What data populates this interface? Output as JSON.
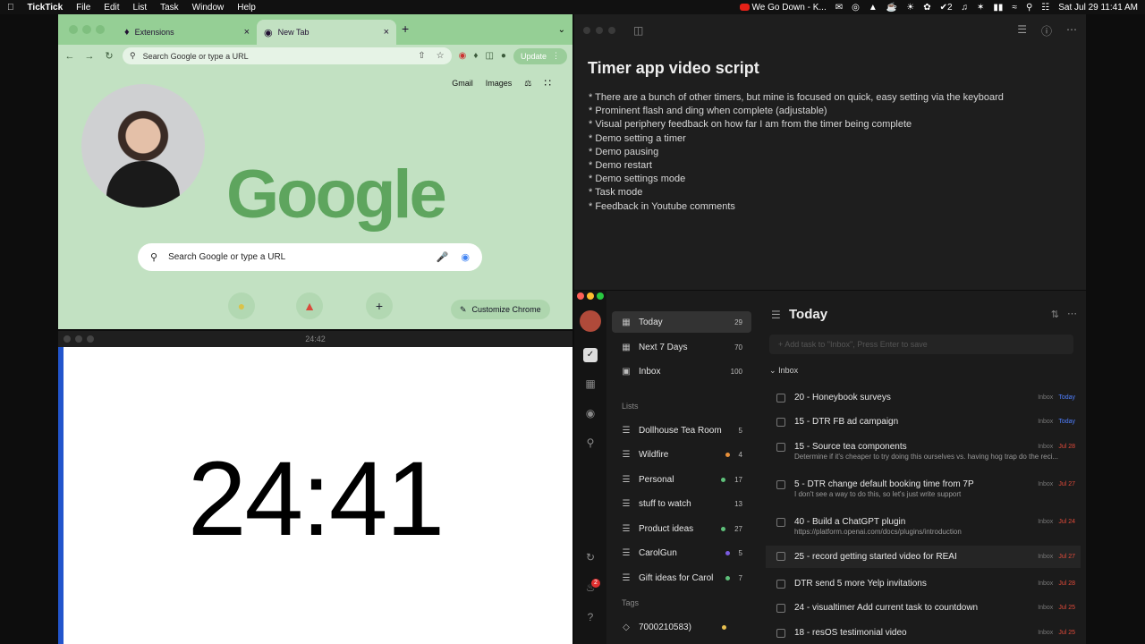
{
  "menubar": {
    "app": "TickTick",
    "menus": [
      "File",
      "Edit",
      "List",
      "Task",
      "Window",
      "Help"
    ],
    "now_playing": "We Go Down - K...",
    "badge_count": "2",
    "clock": "Sat Jul 29  11:41 AM"
  },
  "chrome": {
    "tabs": [
      {
        "label": "Extensions",
        "active": false
      },
      {
        "label": "New Tab",
        "active": true
      }
    ],
    "omnibox_placeholder": "Search Google or type a URL",
    "update_label": "Update",
    "links": [
      "Gmail",
      "Images"
    ],
    "logo": "Google",
    "search_placeholder": "Search Google or type a URL",
    "customize_label": "Customize Chrome"
  },
  "timer": {
    "window_title": "24:42",
    "value": "24:41"
  },
  "notes": {
    "title": "Timer app video script",
    "lines": [
      "* There are a bunch of other timers, but mine is focused on quick, easy setting via the keyboard",
      "* Prominent flash and ding when complete (adjustable)",
      "* Visual periphery feedback on how far I am from the timer being complete",
      "* Demo setting a timer",
      "* Demo pausing",
      "* Demo restart",
      "* Demo settings mode",
      "* Task mode",
      "* Feedback in Youtube comments"
    ]
  },
  "ticktick": {
    "nav": [
      {
        "label": "Today",
        "count": "29",
        "icon": "calendar-today-icon",
        "selected": true
      },
      {
        "label": "Next 7 Days",
        "count": "70",
        "icon": "calendar-week-icon",
        "selected": false
      },
      {
        "label": "Inbox",
        "count": "100",
        "icon": "inbox-icon",
        "selected": false
      }
    ],
    "lists_header": "Lists",
    "lists": [
      {
        "label": "Dollhouse Tea Room",
        "count": "5",
        "dot": ""
      },
      {
        "label": "Wildfire",
        "count": "4",
        "dot": "#e8903a"
      },
      {
        "label": "Personal",
        "count": "17",
        "dot": "#5ec07a"
      },
      {
        "label": "stuff to watch",
        "count": "13",
        "dot": ""
      },
      {
        "label": "Product ideas",
        "count": "27",
        "dot": "#5ec07a"
      },
      {
        "label": "CarolGun",
        "count": "5",
        "dot": "#7a5ce0"
      },
      {
        "label": "Gift ideas for Carol",
        "count": "7",
        "dot": "#5ec07a"
      }
    ],
    "tags_header": "Tags",
    "tags": [
      {
        "label": "7000210583)",
        "dot": "#e8c050"
      }
    ],
    "title": "Today",
    "add_placeholder": "+ Add task to \"Inbox\", Press Enter to save",
    "section": "Inbox",
    "tasks": [
      {
        "title": "20 - Honeybook surveys",
        "note": "",
        "project": "Inbox",
        "due": "Today",
        "today": true
      },
      {
        "title": "15 - DTR FB ad campaign",
        "note": "",
        "project": "Inbox",
        "due": "Today",
        "today": true
      },
      {
        "title": "15 - Source tea components",
        "note": "Determine if it's cheaper to try doing this ourselves vs. having hog trap do the reci...",
        "project": "Inbox",
        "due": "Jul 28",
        "today": false
      },
      {
        "title": "5 - DTR change default booking time from 7P",
        "note": "I don't see a way to do this, so let's just write support",
        "project": "Inbox",
        "due": "Jul 27",
        "today": false
      },
      {
        "title": "40 - Build a ChatGPT plugin",
        "note": "https://platform.openai.com/docs/plugins/introduction",
        "project": "Inbox",
        "due": "Jul 24",
        "today": false
      },
      {
        "title": "25 - record getting started video for REAI",
        "note": "",
        "project": "Inbox",
        "due": "Jul 27",
        "today": false
      },
      {
        "title": "DTR send 5 more Yelp invitations",
        "note": "",
        "project": "Inbox",
        "due": "Jul 28",
        "today": false
      },
      {
        "title": "24 - visualtimer Add current task to countdown",
        "note": "",
        "project": "Inbox",
        "due": "Jul 25",
        "today": false
      },
      {
        "title": "18 - resOS testimonial video",
        "note": "",
        "project": "Inbox",
        "due": "Jul 25",
        "today": false
      }
    ]
  },
  "colors": {
    "chrome_bg": "#c2e1c2",
    "chrome_tabstrip": "#95cf95",
    "timer_bar": "#2255cc",
    "overdue": "#e04a3a",
    "today": "#4f7fff"
  }
}
